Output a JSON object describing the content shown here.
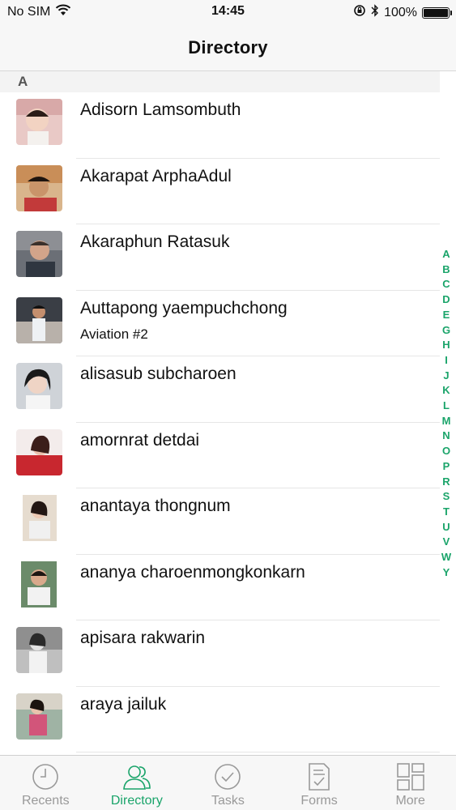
{
  "status": {
    "carrier": "No SIM",
    "time": "14:45",
    "battery": "100%"
  },
  "nav": {
    "title": "Directory"
  },
  "section": {
    "letter": "A"
  },
  "contacts": [
    {
      "name": "Adisorn Lamsombuth",
      "subtitle": ""
    },
    {
      "name": "Akarapat ArphaAdul",
      "subtitle": ""
    },
    {
      "name": "Akaraphun Ratasuk",
      "subtitle": ""
    },
    {
      "name": "Auttapong yaempuchchong",
      "subtitle": "Aviation #2"
    },
    {
      "name": "alisasub subcharoen",
      "subtitle": ""
    },
    {
      "name": "amornrat detdai",
      "subtitle": ""
    },
    {
      "name": "anantaya thongnum",
      "subtitle": ""
    },
    {
      "name": "ananya charoenmongkonkarn",
      "subtitle": ""
    },
    {
      "name": "apisara rakwarin",
      "subtitle": ""
    },
    {
      "name": "araya jailuk",
      "subtitle": ""
    }
  ],
  "index_letters": [
    "A",
    "B",
    "C",
    "D",
    "E",
    "G",
    "H",
    "I",
    "J",
    "K",
    "L",
    "M",
    "N",
    "O",
    "P",
    "R",
    "S",
    "T",
    "U",
    "V",
    "W",
    "Y"
  ],
  "tabs": [
    {
      "label": "Recents",
      "icon": "clock-icon",
      "active": false
    },
    {
      "label": "Directory",
      "icon": "people-icon",
      "active": true
    },
    {
      "label": "Tasks",
      "icon": "checkmark-circle-icon",
      "active": false
    },
    {
      "label": "Forms",
      "icon": "form-document-icon",
      "active": false
    },
    {
      "label": "More",
      "icon": "grid-icon",
      "active": false
    }
  ],
  "colors": {
    "accent": "#1aa46a",
    "inactive_tab": "#999999"
  }
}
